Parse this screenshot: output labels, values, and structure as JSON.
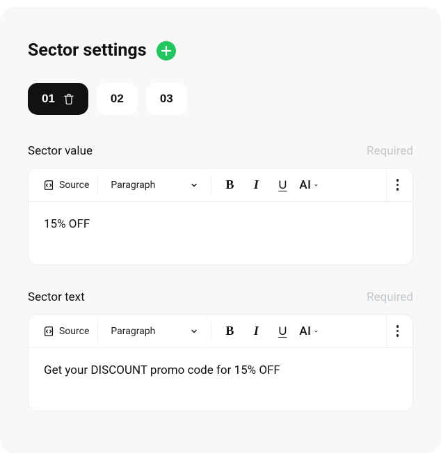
{
  "title": "Sector settings",
  "tabs": [
    "01",
    "02",
    "03"
  ],
  "active_tab_index": 0,
  "required_label": "Required",
  "toolbar": {
    "source_label": "Source",
    "paragraph_label": "Paragraph",
    "ai_label": "AI"
  },
  "fields": [
    {
      "label": "Sector value",
      "content": "15% OFF"
    },
    {
      "label": "Sector text",
      "content": "Get your DISCOUNT promo code for 15% OFF"
    }
  ]
}
